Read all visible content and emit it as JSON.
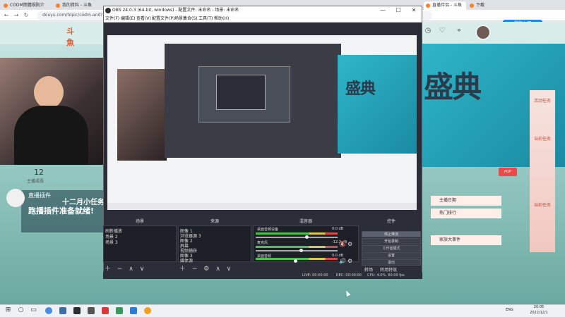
{
  "browser": {
    "tabs": [
      {
        "label": "CODM簡體規則介",
        "active": false
      },
      {
        "label": "我的資料 - 斗魚",
        "active": false
      },
      {
        "label": "直播伴侶 - 斗魚",
        "active": true
      },
      {
        "label": "下載",
        "active": false
      }
    ],
    "url": "douyu.com/topic/codm-and?rid=...",
    "login_label": "登錄上網",
    "site_logo": "斗魚",
    "banner_text": "盛典",
    "viewer_count": "12",
    "viewer_label": "主播成長",
    "card_title": "直播插件",
    "card_headline": "十二月小任务",
    "card_sub": "跑播插件准备就绪!",
    "right_cards": [
      "主播日期",
      "热门排行",
      "家族大事件"
    ],
    "side_labels": [
      "活动任务",
      "当前任务",
      "当前任务"
    ],
    "badge": "POP"
  },
  "obs": {
    "title": "OBS 24.0.3 (64-bit, windows) - 配置文件: 未命名 - 场景: 未命名",
    "menu": [
      "文件(F)",
      "编辑(E)",
      "查看(V)",
      "配置文件(P)",
      "场景集合(S)",
      "工具(T)",
      "帮助(H)"
    ],
    "docks": {
      "scenes": {
        "title": "场景",
        "items": [
          "刷新播放",
          "场景 2",
          "场景 3"
        ]
      },
      "sources": {
        "title": "来源",
        "items": [
          "图像 1",
          "浏览器源 3",
          "图像 2",
          "屏幕",
          "视频捕获",
          "图像 3",
          "媒体源"
        ]
      },
      "mixer": {
        "title": "混音器",
        "tracks": [
          {
            "name": "桌面音频设备",
            "db": "0.0 dB"
          },
          {
            "name": "麦克风",
            "db": "-12.2 dB"
          },
          {
            "name": "桌面音频",
            "db": "0.0 dB"
          }
        ]
      },
      "controls": {
        "title": "控件",
        "buttons": [
          "停止推流",
          "开始录制",
          "工作室模式",
          "设置",
          "退出"
        ]
      }
    },
    "transitions": {
      "label": "转场",
      "sub": "转场特效"
    },
    "status": {
      "live": "LIVE: 00:00:00",
      "rec": "REC: 00:00:00",
      "cpu": "CPU: 4.0%, 60.00 fps"
    },
    "mixer_levels": [
      0.62,
      0.55,
      0.48
    ]
  },
  "taskbar": {
    "time": "20:05",
    "date": "2022/12/1",
    "lang": "ENG"
  }
}
